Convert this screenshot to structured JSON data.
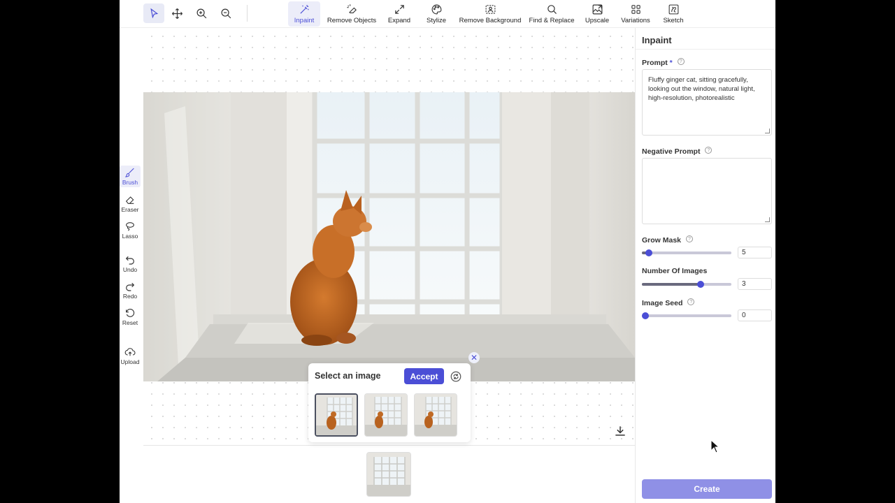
{
  "toolbar": {
    "nav_icons": [
      "select-icon",
      "move-icon",
      "zoom-in-icon",
      "zoom-out-icon"
    ],
    "tools": [
      {
        "label": "Inpaint",
        "icon": "magic-wand-icon",
        "active": true
      },
      {
        "label": "Remove Objects",
        "icon": "eraser-sparkle-icon",
        "active": false
      },
      {
        "label": "Expand",
        "icon": "expand-arrows-icon",
        "active": false
      },
      {
        "label": "Stylize",
        "icon": "palette-icon",
        "active": false
      },
      {
        "label": "Remove Background",
        "icon": "image-cutout-icon",
        "active": false
      },
      {
        "label": "Find & Replace",
        "icon": "search-icon",
        "active": false
      },
      {
        "label": "Upscale",
        "icon": "upscale-image-icon",
        "active": false
      },
      {
        "label": "Variations",
        "icon": "grid-icon",
        "active": false
      },
      {
        "label": "Sketch",
        "icon": "sketch-icon",
        "active": false
      }
    ]
  },
  "left_tools": {
    "brush": "Brush",
    "eraser": "Eraser",
    "lasso": "Lasso",
    "undo": "Undo",
    "redo": "Redo",
    "reset": "Reset",
    "upload": "Upload"
  },
  "popup": {
    "title": "Select an image",
    "accept_label": "Accept",
    "selected_index": 0,
    "thumbnail_count": 3
  },
  "panel": {
    "title": "Inpaint",
    "prompt_label": "Prompt",
    "prompt_required_mark": "*",
    "prompt_value": "Fluffy ginger cat, sitting gracefully, looking out the window, natural light, high-resolution, photorealistic",
    "negative_prompt_label": "Negative Prompt",
    "negative_prompt_value": "",
    "grow_mask_label": "Grow Mask",
    "grow_mask_value": "5",
    "grow_mask_fraction": 0.08,
    "number_of_images_label": "Number Of Images",
    "number_of_images_value": "3",
    "number_of_images_fraction": 0.66,
    "image_seed_label": "Image Seed",
    "image_seed_value": "0",
    "image_seed_fraction": 0.0,
    "create_label": "Create"
  },
  "colors": {
    "accent": "#4b4ed6",
    "create_button": "#8f90e6",
    "active_tool_bg": "#ecedf9"
  }
}
